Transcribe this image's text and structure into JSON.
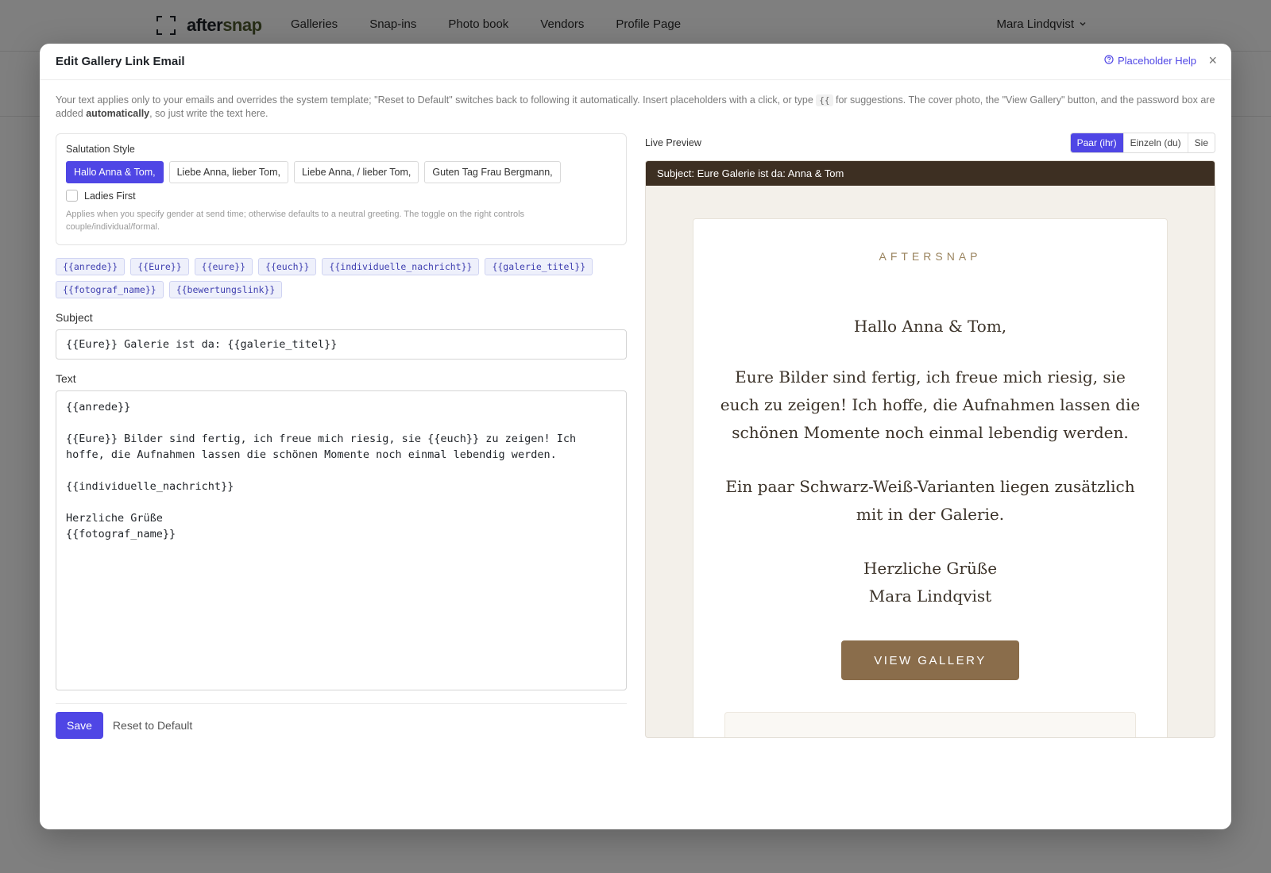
{
  "app": {
    "logo_text_a": "after",
    "logo_text_b": "snap",
    "nav": [
      "Galleries",
      "Snap-ins",
      "Photo book",
      "Vendors",
      "Profile Page"
    ],
    "user_name": "Mara Lindqvist"
  },
  "modal": {
    "title": "Edit Gallery Link Email",
    "help_label": "Placeholder Help",
    "close_glyph": "×",
    "intro_a": "Your text applies only to your emails and overrides the system template; \"Reset to Default\" switches back to following it automatically. Insert placeholders with a click, or type ",
    "intro_code": "{{",
    "intro_b": " for suggestions. The cover photo, the \"View Gallery\" button, and the password box are added ",
    "intro_bold": "automatically",
    "intro_c": ", so just write the text here."
  },
  "salutation": {
    "label": "Salutation Style",
    "options": [
      "Hallo Anna & Tom,",
      "Liebe Anna, lieber Tom,",
      "Liebe Anna, / lieber Tom,",
      "Guten Tag Frau Bergmann,"
    ],
    "selected_index": 0,
    "ladies_first_label": "Ladies First",
    "ladies_first_checked": false,
    "note": "Applies when you specify gender at send time; otherwise defaults to a neutral greeting. The toggle on the right controls couple/individual/formal."
  },
  "placeholders": [
    "{{anrede}}",
    "{{Eure}}",
    "{{eure}}",
    "{{euch}}",
    "{{individuelle_nachricht}}",
    "{{galerie_titel}}",
    "{{fotograf_name}}",
    "{{bewertungslink}}"
  ],
  "subject": {
    "label": "Subject",
    "value": "{{Eure}} Galerie ist da: {{galerie_titel}}"
  },
  "text": {
    "label": "Text",
    "value": "{{anrede}}\n\n{{Eure}} Bilder sind fertig, ich freue mich riesig, sie {{euch}} zu zeigen! Ich hoffe, die Aufnahmen lassen die schönen Momente noch einmal lebendig werden.\n\n{{individuelle_nachricht}}\n\nHerzliche Grüße\n{{fotograf_name}}"
  },
  "actions": {
    "save": "Save",
    "reset": "Reset to Default"
  },
  "preview": {
    "label": "Live Preview",
    "modes": [
      "Paar (ihr)",
      "Einzeln (du)",
      "Sie"
    ],
    "selected_mode": 0,
    "subject_line": "Subject: Eure Galerie ist da: Anna & Tom",
    "brand": "AFTERSNAP",
    "greeting": "Hallo Anna & Tom,",
    "paragraph1": "Eure Bilder sind fertig, ich freue mich riesig, sie euch zu zeigen! Ich hoffe, die Aufnahmen lassen die schönen Momente noch einmal lebendig werden.",
    "paragraph2": "Ein paar Schwarz-Weiß-Varianten liegen zusätzlich mit in der Galerie.",
    "closing_line1": "Herzliche Grüße",
    "closing_line2": "Mara Lindqvist",
    "button": "VIEW GALLERY"
  },
  "colors": {
    "accent": "#4f46e5",
    "email_header": "#3d2f22",
    "email_button": "#8a6d4b",
    "brand_text": "#9b8560"
  }
}
